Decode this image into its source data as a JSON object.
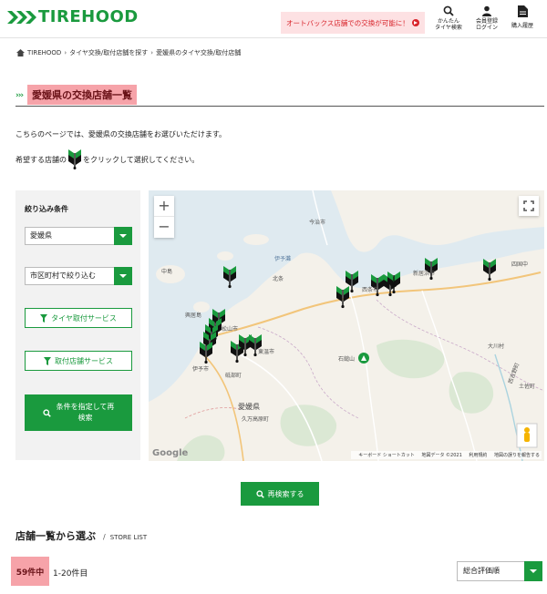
{
  "header": {
    "logo_text": "TIREHOOD",
    "promo_text": "オートバックス店舗での交換が可能に！",
    "nav": [
      {
        "line1": "かんたん",
        "line2": "タイヤ検索",
        "icon": "search-icon"
      },
      {
        "line1": "会員登録",
        "line2": "ログイン",
        "icon": "person-icon"
      },
      {
        "line1": "購入履歴",
        "line2": "",
        "icon": "document-icon"
      }
    ]
  },
  "breadcrumb": [
    "TIREHOOD",
    "タイヤ交換/取付店舗を探す",
    "愛媛県のタイヤ交換/取付店舗"
  ],
  "page": {
    "title": "愛媛県の交換店舗一覧",
    "intro1": "こちらのページでは、愛媛県の交換店舗をお選びいただけます。",
    "intro2_before": "希望する店舗の",
    "intro2_after": "をクリックして選択してください。"
  },
  "filters": {
    "title": "絞り込み条件",
    "prefecture": "愛媛県",
    "city_placeholder": "市区町村で絞り込む",
    "tire_service": "タイヤ取付サービス",
    "shop_service": "取付店舗サービス",
    "search_line1": "条件を指定して再",
    "search_line2": "検索"
  },
  "map": {
    "labels": {
      "doumura": "今治市",
      "nakajima": "中島",
      "kokyo": "興居島",
      "iyo": "伊予市",
      "tobe": "砥部町",
      "toon": "東温市",
      "matsuyama": "松山市",
      "ehime": "愛媛県",
      "kumakogen": "久万高原町",
      "ishizuchi": "石鎚山",
      "saijo": "西条市",
      "niihama": "新居浜市",
      "shikokuchuo": "四国中",
      "okawa": "大川村",
      "tosa": "土佐町",
      "nishiyoshino": "西吉野町",
      "hojo": "北条",
      "iyonada": "伊予灘"
    },
    "attribution": [
      "キーボード ショートカット",
      "地図データ ©2021",
      "利用規約",
      "地図の誤りを報告する"
    ],
    "google": "Google",
    "zoom_in": "+",
    "zoom_out": "−"
  },
  "buttons": {
    "research": "再検索する"
  },
  "list": {
    "heading": "店舗一覧から選ぶ",
    "slash": "/",
    "heading_en": "STORE LIST",
    "count": "59件中",
    "range": "1-20件目",
    "sort": "総合評価順"
  },
  "colors": {
    "brand_green": "#1a9a3e",
    "highlight_pink": "#f6a3a9",
    "promo_red": "#d8232a"
  }
}
